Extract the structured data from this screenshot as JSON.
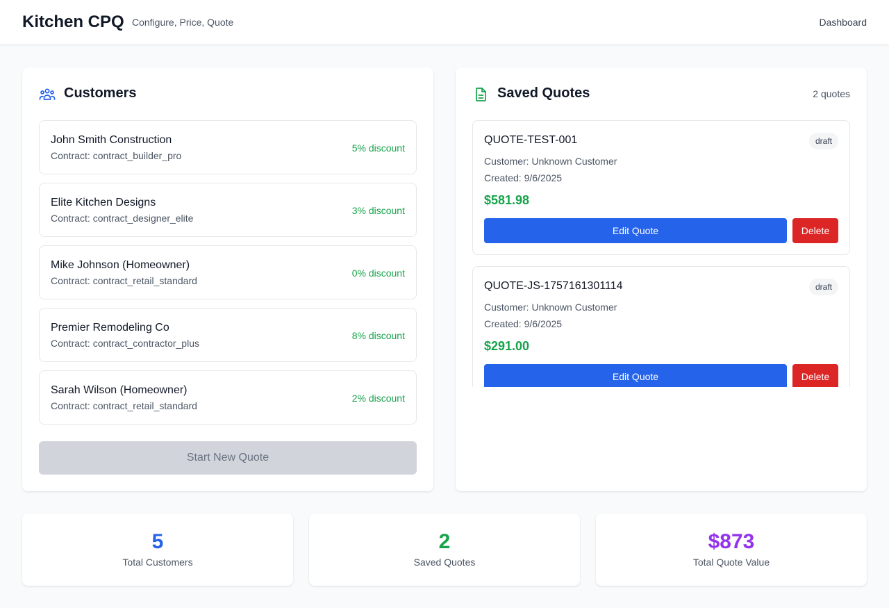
{
  "header": {
    "title": "Kitchen CPQ",
    "tagline": "Configure, Price, Quote",
    "nav_link": "Dashboard"
  },
  "customers_panel": {
    "title": "Customers",
    "icon": "users-icon",
    "icon_color": "#2563eb",
    "items": [
      {
        "name": "John Smith Construction",
        "contract": "Contract: contract_builder_pro",
        "discount": "5% discount"
      },
      {
        "name": "Elite Kitchen Designs",
        "contract": "Contract: contract_designer_elite",
        "discount": "3% discount"
      },
      {
        "name": "Mike Johnson (Homeowner)",
        "contract": "Contract: contract_retail_standard",
        "discount": "0% discount"
      },
      {
        "name": "Premier Remodeling Co",
        "contract": "Contract: contract_contractor_plus",
        "discount": "8% discount"
      },
      {
        "name": "Sarah Wilson (Homeowner)",
        "contract": "Contract: contract_retail_standard",
        "discount": "2% discount"
      }
    ],
    "start_button": "Start New Quote",
    "start_button_disabled": true
  },
  "quotes_panel": {
    "title": "Saved Quotes",
    "icon": "document-icon",
    "icon_color": "#16a34a",
    "count": "2 quotes",
    "items": [
      {
        "id": "QUOTE-TEST-001",
        "status": "draft",
        "customer": "Customer: Unknown Customer",
        "created": "Created: 9/6/2025",
        "total": "$581.98",
        "edit_label": "Edit Quote",
        "delete_label": "Delete"
      },
      {
        "id": "QUOTE-JS-1757161301114",
        "status": "draft",
        "customer": "Customer: Unknown Customer",
        "created": "Created: 9/6/2025",
        "total": "$291.00",
        "edit_label": "Edit Quote",
        "delete_label": "Delete"
      }
    ]
  },
  "stats": [
    {
      "value": "5",
      "label": "Total Customers",
      "color": "#2563eb"
    },
    {
      "value": "2",
      "label": "Saved Quotes",
      "color": "#16a34a"
    },
    {
      "value": "$873",
      "label": "Total Quote Value",
      "color": "#9333ea"
    }
  ]
}
